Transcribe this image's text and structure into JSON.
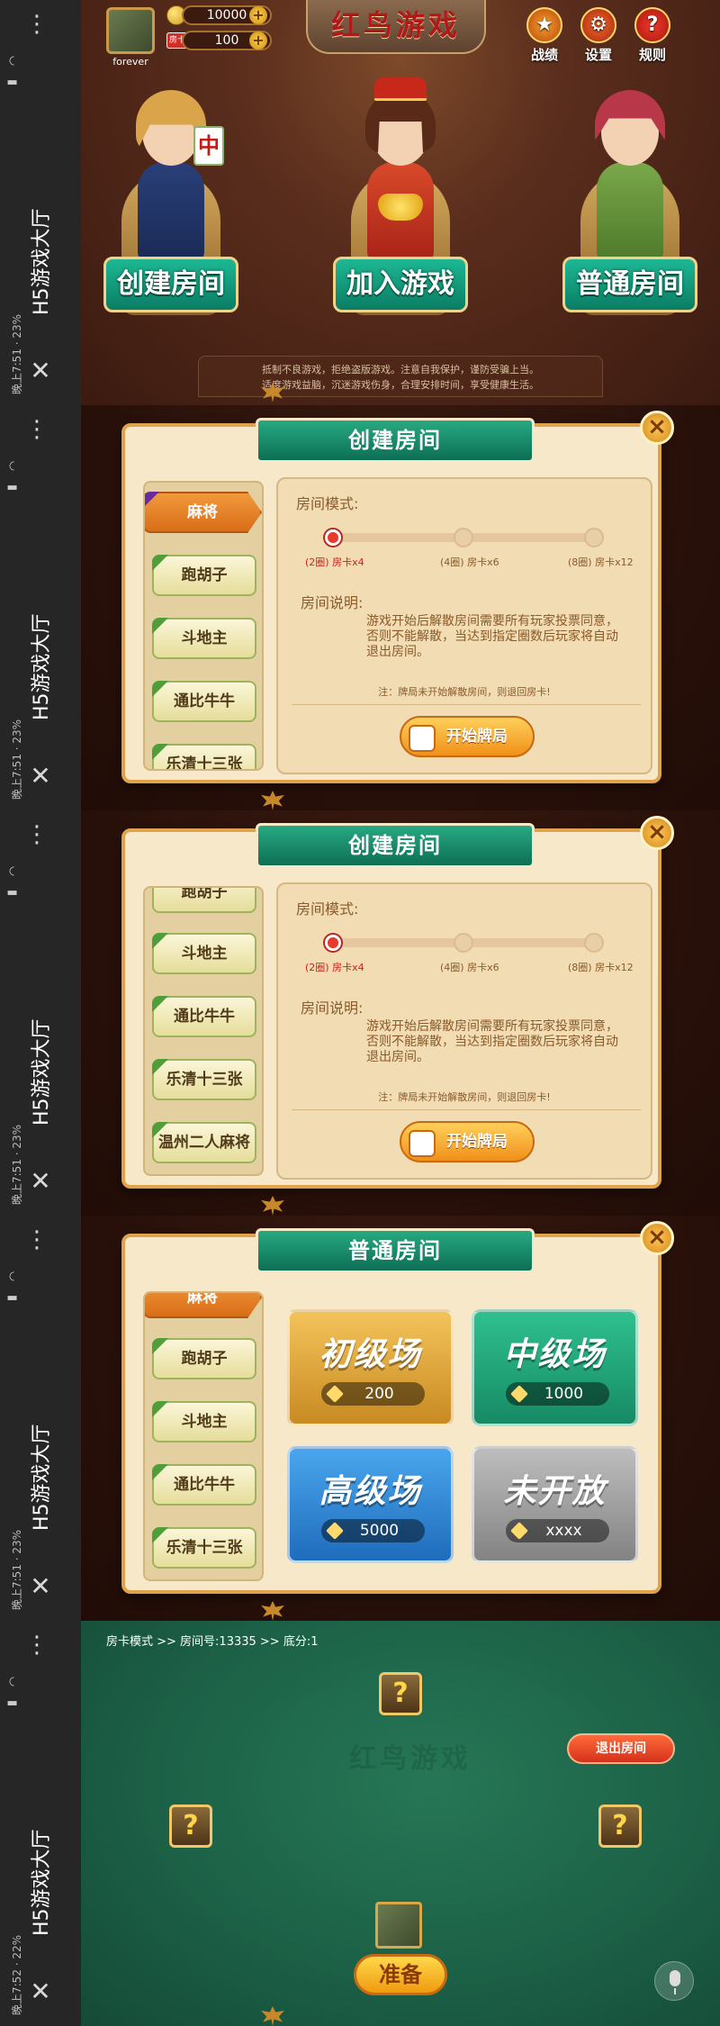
{
  "status_bar": {
    "app_title": "H5游戏大厅",
    "menu_dots": "⋮",
    "close_glyph": "✕",
    "frames": [
      {
        "time": "晚上7:51",
        "battery": "23%"
      },
      {
        "time": "晚上7:51",
        "battery": "23%"
      },
      {
        "time": "晚上7:51",
        "battery": "23%"
      },
      {
        "time": "晚上7:51",
        "battery": "23%"
      },
      {
        "time": "晚上7:52",
        "battery": "22%"
      }
    ]
  },
  "lobby": {
    "player_name": "forever",
    "gold": "10000",
    "room_cards": "100",
    "room_card_icon_text": "房卡",
    "plus": "+",
    "logo": "红鸟游戏",
    "top_icons": [
      {
        "label": "战绩",
        "icon": "medal-icon",
        "glyph": "★"
      },
      {
        "label": "设置",
        "icon": "gear-icon",
        "glyph": "⚙"
      },
      {
        "label": "规则",
        "icon": "question-icon",
        "glyph": "?"
      }
    ],
    "characters": [
      {
        "label": "创建房间",
        "tile": "中"
      },
      {
        "label": "加入游戏"
      },
      {
        "label": "普通房间"
      }
    ],
    "notice_lines": [
      "抵制不良游戏，拒绝盗版游戏。注意自我保护，谨防受骗上当。",
      "适度游戏益脑，沉迷游戏伤身，合理安排时间，享受健康生活。"
    ]
  },
  "create_room": {
    "title": "创建房间",
    "close": "×",
    "games_frame2": [
      "麻将",
      "跑胡子",
      "斗地主",
      "通比牛牛",
      "乐清十三张"
    ],
    "games_frame3": [
      "跑胡子",
      "斗地主",
      "通比牛牛",
      "乐清十三张",
      "温州二人麻将"
    ],
    "selected_game": "麻将",
    "mode_label": "房间模式:",
    "modes": [
      {
        "rounds": "(2圈)",
        "cards": "房卡x4",
        "active": true
      },
      {
        "rounds": "(4圈)",
        "cards": "房卡x6",
        "active": false
      },
      {
        "rounds": "(8圈)",
        "cards": "房卡x12",
        "active": false
      }
    ],
    "desc_label": "房间说明:",
    "desc_text": "游戏开始后解散房间需要所有玩家投票同意，否则不能解散，当达到指定圈数后玩家将自动退出房间。",
    "note": "注：牌局未开始解散房间，则退回房卡!",
    "start_button": "开始牌局"
  },
  "normal_room": {
    "title": "普通房间",
    "close": "×",
    "games": [
      "麻将",
      "跑胡子",
      "斗地主",
      "通比牛牛",
      "乐清十三张"
    ],
    "arenas": [
      {
        "name": "初级场",
        "value": "200",
        "color": "#d9a53a"
      },
      {
        "name": "中级场",
        "value": "1000",
        "color": "#1f9e74"
      },
      {
        "name": "高级场",
        "value": "5000",
        "color": "#2a7fd0"
      },
      {
        "name": "未开放",
        "value": "xxxx",
        "color": "#9a9a9a"
      }
    ]
  },
  "table": {
    "room_info": "房卡模式 >> 房间号:13335 >> 底分:1",
    "logo": "红鸟游戏",
    "seat_glyph": "?",
    "exit_button": "退出房间",
    "ready_button": "准备"
  }
}
